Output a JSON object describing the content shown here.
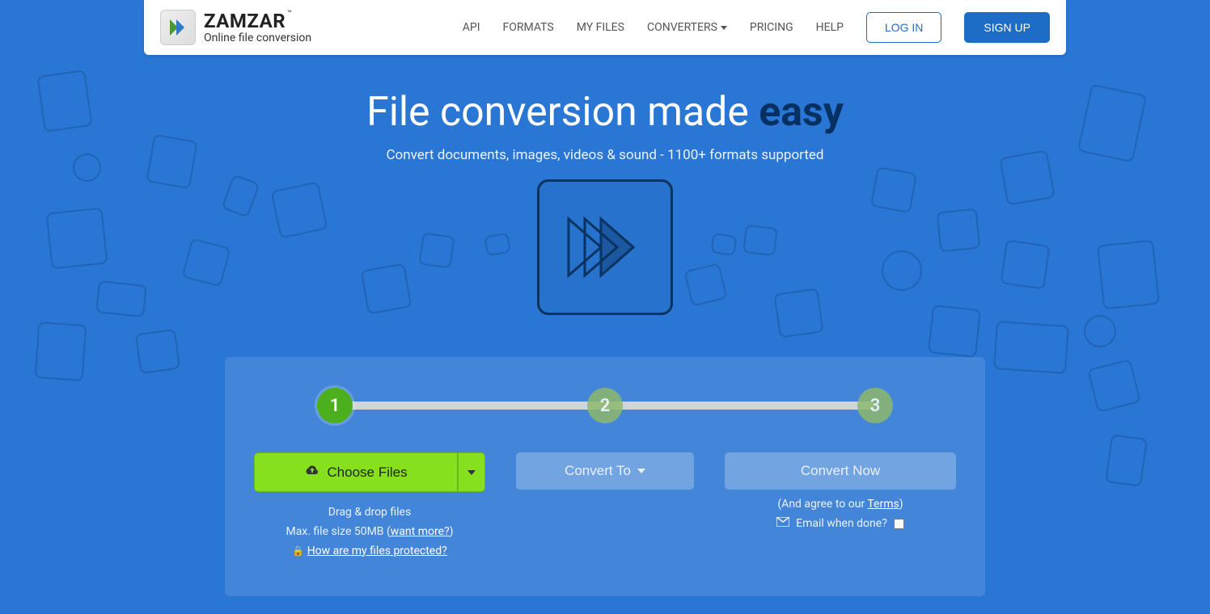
{
  "brand": {
    "title": "ZAMZAR",
    "tm": "™",
    "subtitle": "Online file conversion"
  },
  "nav": {
    "api": "API",
    "formats": "FORMATS",
    "myfiles": "MY FILES",
    "converters": "CONVERTERS",
    "pricing": "PRICING",
    "help": "HELP",
    "login": "LOG IN",
    "signup": "SIGN UP"
  },
  "hero": {
    "title_pre": "File conversion made ",
    "title_em": "easy",
    "subtitle": "Convert documents, images, videos & sound - 1100+ formats supported"
  },
  "steps": {
    "s1": "1",
    "s2": "2",
    "s3": "3"
  },
  "actions": {
    "choose": "Choose Files",
    "convert_to": "Convert To",
    "convert_now": "Convert Now"
  },
  "hints": {
    "drag": "Drag & drop files",
    "max_pre": "Max. file size 50MB (",
    "want_more": "want more?",
    "max_post": ")",
    "protected": "How are my files protected?"
  },
  "terms": {
    "pre": "(And agree to our ",
    "link": "Terms",
    "post": ")"
  },
  "email": {
    "label": "Email when done?"
  }
}
